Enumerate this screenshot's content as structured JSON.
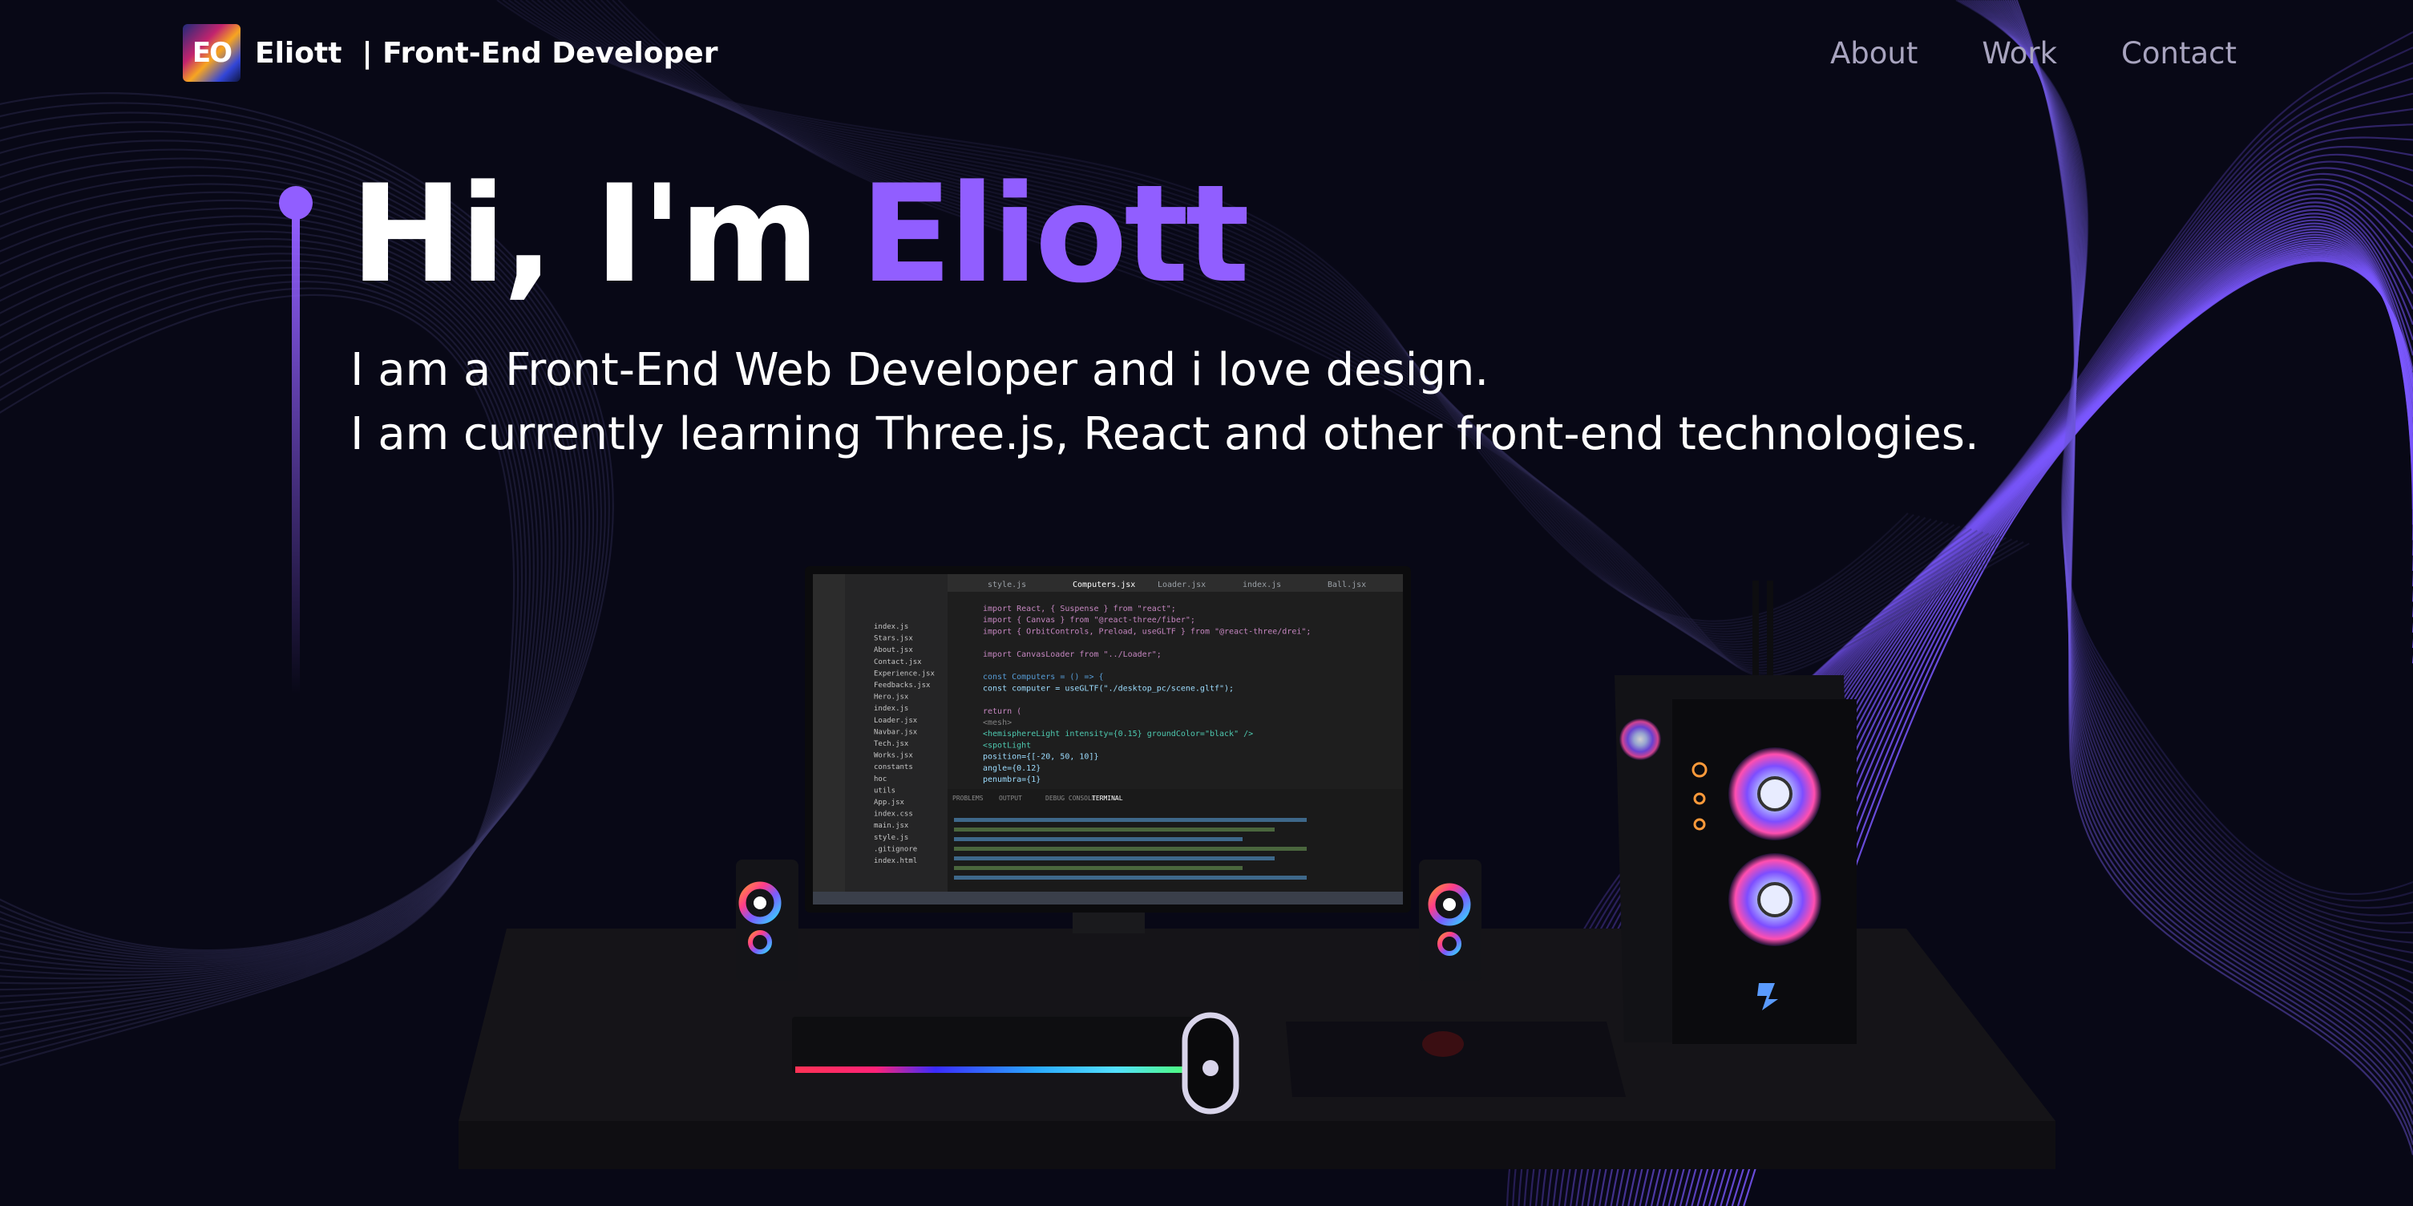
{
  "navbar": {
    "logo_text": "EO",
    "brand_title": "Eliott  | Front-End Developer",
    "links": [
      "About",
      "Work",
      "Contact"
    ]
  },
  "hero": {
    "greeting": "Hi, I'm ",
    "name": "Eliott",
    "line1": "I am a Front-End Web Developer and i love design.",
    "line2": "I am currently learning Three.js, React and other front-end technologies."
  },
  "colors": {
    "background": "#080816",
    "accent": "#915eff",
    "text": "#ffffff",
    "nav_text": "#a8a4bf"
  },
  "scene": {
    "editor_tabs": [
      "style.js",
      "Computers.jsx",
      "Loader.jsx",
      "index.js",
      "Ball.jsx"
    ],
    "code_lines": [
      "import React, { Suspense } from \"react\";",
      "import { Canvas } from \"@react-three/fiber\";",
      "import { OrbitControls, Preload, useGLTF } from \"@react-three/drei\";",
      "",
      "import CanvasLoader from \"../Loader\";",
      "",
      "const Computers = () => {",
      "  const computer = useGLTF(\"./desktop_pc/scene.gltf\");",
      "",
      "  return (",
      "    <mesh>",
      "      <hemisphereLight intensity={0.15} groundColor=\"black\" />",
      "      <spotLight",
      "        position={[-20, 50, 10]}",
      "        angle={0.12}",
      "        penumbra={1}"
    ],
    "panel_tabs": [
      "PROBLEMS",
      "OUTPUT",
      "DEBUG CONSOLE",
      "TERMINAL"
    ],
    "explorer_files": [
      "index.js",
      "Stars.jsx",
      "About.jsx",
      "Contact.jsx",
      "Experience.jsx",
      "Feedbacks.jsx",
      "Hero.jsx",
      "index.js",
      "Loader.jsx",
      "Navbar.jsx",
      "Tech.jsx",
      "Works.jsx",
      "constants",
      "hoc",
      "utils",
      "App.jsx",
      "index.css",
      "main.jsx",
      "style.js",
      ".gitignore",
      "index.html"
    ]
  }
}
